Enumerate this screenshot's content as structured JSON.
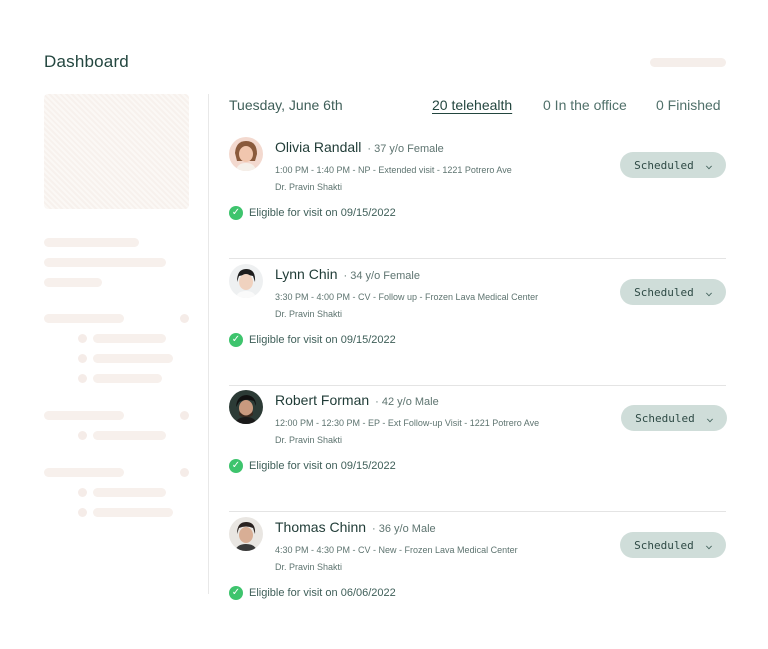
{
  "page": {
    "title": "Dashboard"
  },
  "header": {
    "date": "Tuesday, June 6th",
    "tabs": [
      {
        "label": "20 telehealth",
        "active": true
      },
      {
        "label": "0 In the office",
        "active": false
      },
      {
        "label": "0 Finished",
        "active": false
      }
    ]
  },
  "appointments": [
    {
      "name": "Olivia Randall",
      "demographics": "· 37 y/o Female",
      "details": "1:00 PM - 1:40 PM - NP - Extended visit - 1221 Potrero Ave",
      "provider": "Dr. Pravin Shakti",
      "eligibility": "Eligible for visit on 09/15/2022",
      "status": "Scheduled"
    },
    {
      "name": "Lynn Chin",
      "demographics": "· 34 y/o Female",
      "details": "3:30 PM - 4:00 PM - CV - Follow up - Frozen Lava Medical Center",
      "provider": "Dr. Pravin Shakti",
      "eligibility": "Eligible for visit on 09/15/2022",
      "status": "Scheduled"
    },
    {
      "name": "Robert Forman",
      "demographics": "· 42 y/o Male",
      "details": "12:00 PM - 12:30 PM - EP - Ext Follow-up Visit - 1221 Potrero Ave",
      "provider": "Dr. Pravin Shakti",
      "eligibility": "Eligible for visit on 09/15/2022",
      "status": "Scheduled"
    },
    {
      "name": "Thomas Chinn",
      "demographics": "· 36 y/o Male",
      "details": "4:30 PM - 4:30 PM - CV - New - Frozen Lava Medical Center",
      "provider": "Dr. Pravin Shakti",
      "eligibility": "Eligible for visit on 06/06/2022",
      "status": "Scheduled"
    }
  ],
  "icons": {
    "check": "check-circle-icon",
    "chevron": "chevron-down-icon"
  },
  "colors": {
    "brand_text": "#23463f",
    "status_pill": "#cfddd9",
    "check_green": "#3ec46d",
    "skeleton": "#f7f0ec"
  }
}
